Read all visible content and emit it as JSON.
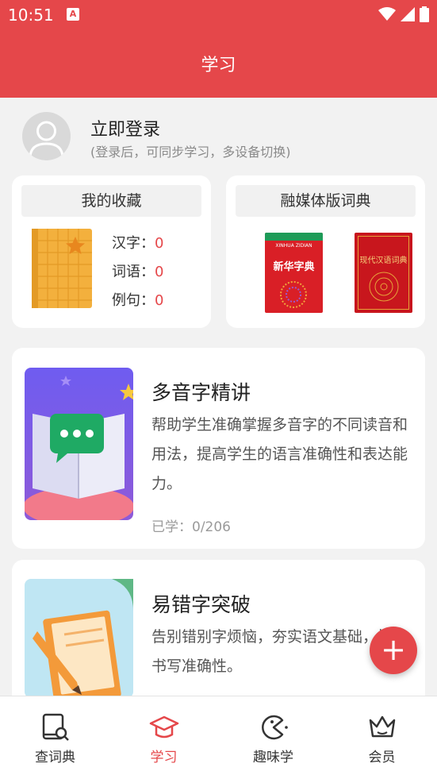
{
  "status": {
    "time": "10:51",
    "app_icon": "A"
  },
  "header": {
    "title": "学习"
  },
  "login": {
    "title": "立即登录",
    "subtitle": "(登录后，可同步学习，多设备切换)"
  },
  "favorites": {
    "title": "我的收藏",
    "items": [
      {
        "label": "汉字：",
        "count": "0"
      },
      {
        "label": "词语：",
        "count": "0"
      },
      {
        "label": "例句：",
        "count": "0"
      }
    ]
  },
  "dictionary": {
    "title": "融媒体版词典",
    "book1": "新华字典",
    "book1_pinyin": "XINHUA ZIDIAN",
    "book2": "现代汉语词典"
  },
  "courses": [
    {
      "title": "多音字精讲",
      "desc": "帮助学生准确掌握多音字的不同读音和用法，提高学生的语言准确性和表达能力。",
      "progress": "已学：0/206"
    },
    {
      "title": "易错字突破",
      "desc": "告别错别字烦恼，夯实语文基础，提升书写准确性。"
    }
  ],
  "fab": {
    "label": "+"
  },
  "tabs": [
    {
      "label": "查词典",
      "icon": "dictionary-search-icon"
    },
    {
      "label": "学习",
      "icon": "graduation-cap-icon"
    },
    {
      "label": "趣味学",
      "icon": "pacman-icon"
    },
    {
      "label": "会员",
      "icon": "crown-icon"
    }
  ],
  "colors": {
    "brand": "#e5474a"
  }
}
